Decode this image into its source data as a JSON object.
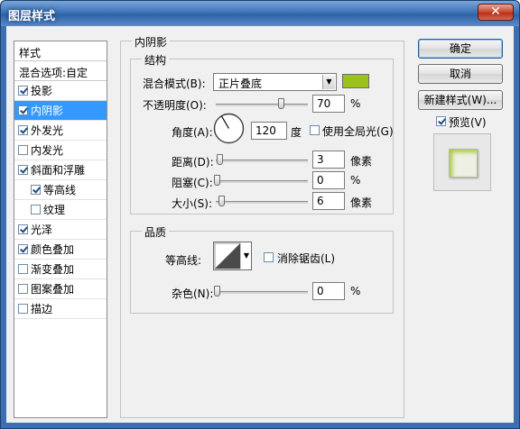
{
  "window": {
    "title": "图层样式",
    "close_symbol": "✕"
  },
  "style_list": {
    "header": "样式",
    "blend_options": "混合选项:自定",
    "items": [
      {
        "label": "投影",
        "checked": true,
        "selected": false,
        "indent": false
      },
      {
        "label": "内阴影",
        "checked": true,
        "selected": true,
        "indent": false
      },
      {
        "label": "外发光",
        "checked": true,
        "selected": false,
        "indent": false
      },
      {
        "label": "内发光",
        "checked": false,
        "selected": false,
        "indent": false
      },
      {
        "label": "斜面和浮雕",
        "checked": true,
        "selected": false,
        "indent": false
      },
      {
        "label": "等高线",
        "checked": true,
        "selected": false,
        "indent": true
      },
      {
        "label": "纹理",
        "checked": false,
        "selected": false,
        "indent": true
      },
      {
        "label": "光泽",
        "checked": true,
        "selected": false,
        "indent": false
      },
      {
        "label": "颜色叠加",
        "checked": true,
        "selected": false,
        "indent": false
      },
      {
        "label": "渐变叠加",
        "checked": false,
        "selected": false,
        "indent": false
      },
      {
        "label": "图案叠加",
        "checked": false,
        "selected": false,
        "indent": false
      },
      {
        "label": "描边",
        "checked": false,
        "selected": false,
        "indent": false
      }
    ]
  },
  "inner_shadow": {
    "title": "内阴影",
    "structure": {
      "title": "结构",
      "blend_mode_label": "混合模式(B):",
      "blend_mode_value": "正片叠底",
      "color": "#9ac21b",
      "opacity_label": "不透明度(O):",
      "opacity_value": "70",
      "opacity_unit": "%",
      "opacity_level": 0.7,
      "angle_label": "角度(A):",
      "angle_value": "120",
      "angle_unit": "度",
      "global_light_label": "使用全局光(G)",
      "global_light_checked": false,
      "distance_label": "距离(D):",
      "distance_value": "3",
      "distance_unit": "像素",
      "choke_label": "阻塞(C):",
      "choke_value": "0",
      "choke_unit": "%",
      "size_label": "大小(S):",
      "size_value": "6",
      "size_unit": "像素"
    },
    "quality": {
      "title": "品质",
      "contour_label": "等高线:",
      "anti_alias_label": "消除锯齿(L)",
      "anti_alias_checked": false,
      "noise_label": "杂色(N):",
      "noise_value": "0",
      "noise_unit": "%"
    }
  },
  "buttons": {
    "ok": "确定",
    "cancel": "取消",
    "new_style": "新建样式(W)...",
    "preview_label": "预览(V)",
    "preview_checked": true
  }
}
